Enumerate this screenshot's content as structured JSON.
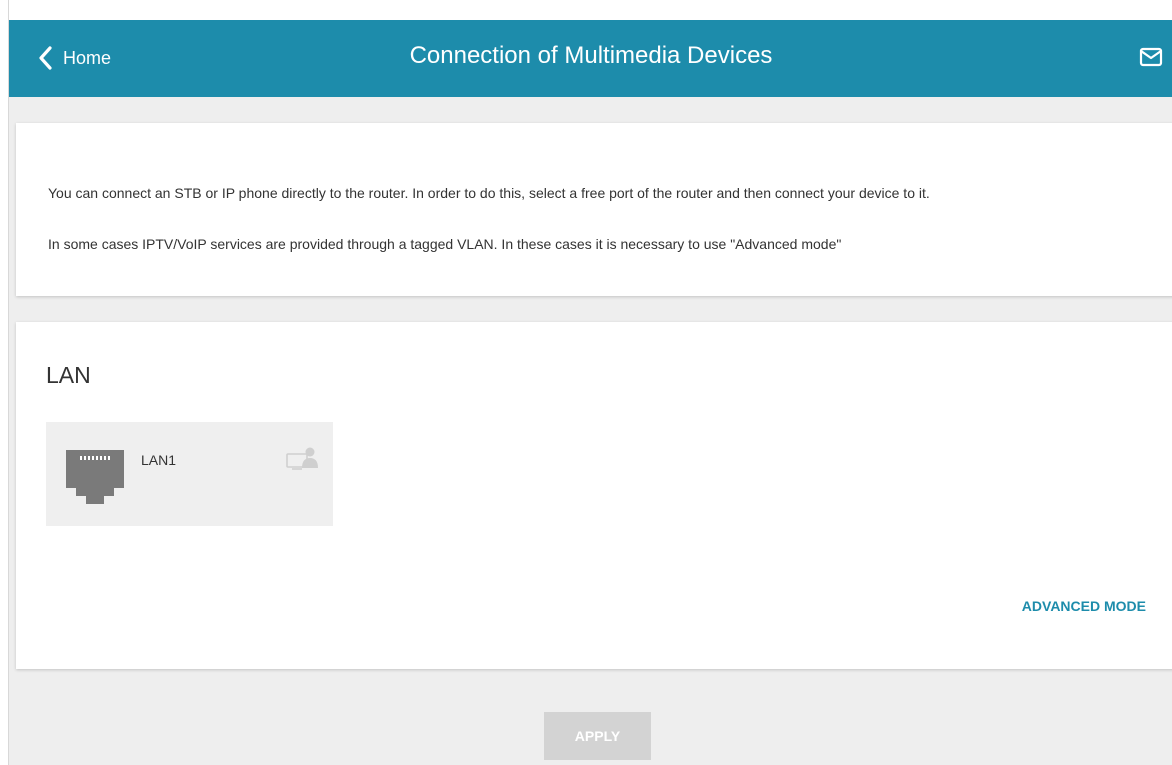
{
  "header": {
    "back_label": "Home",
    "title": "Connection of Multimedia Devices",
    "back_icon": "chevron-left-icon",
    "mail_icon": "mail-icon",
    "color": "#1d8cab"
  },
  "info": {
    "line1": "You can connect an STB or IP phone directly to the router. In order to do this, select a free port of the router and then connect your device to it.",
    "line2": "In some cases IPTV/VoIP services are provided through a tagged VLAN. In these cases it is necessary to use \"Advanced mode\""
  },
  "lan": {
    "title": "LAN",
    "ports": [
      {
        "name": "LAN1",
        "icon": "ethernet-port-icon",
        "device_icon": "media-device-icon"
      }
    ],
    "advanced_label": "ADVANCED MODE"
  },
  "footer": {
    "apply_label": "APPLY"
  }
}
